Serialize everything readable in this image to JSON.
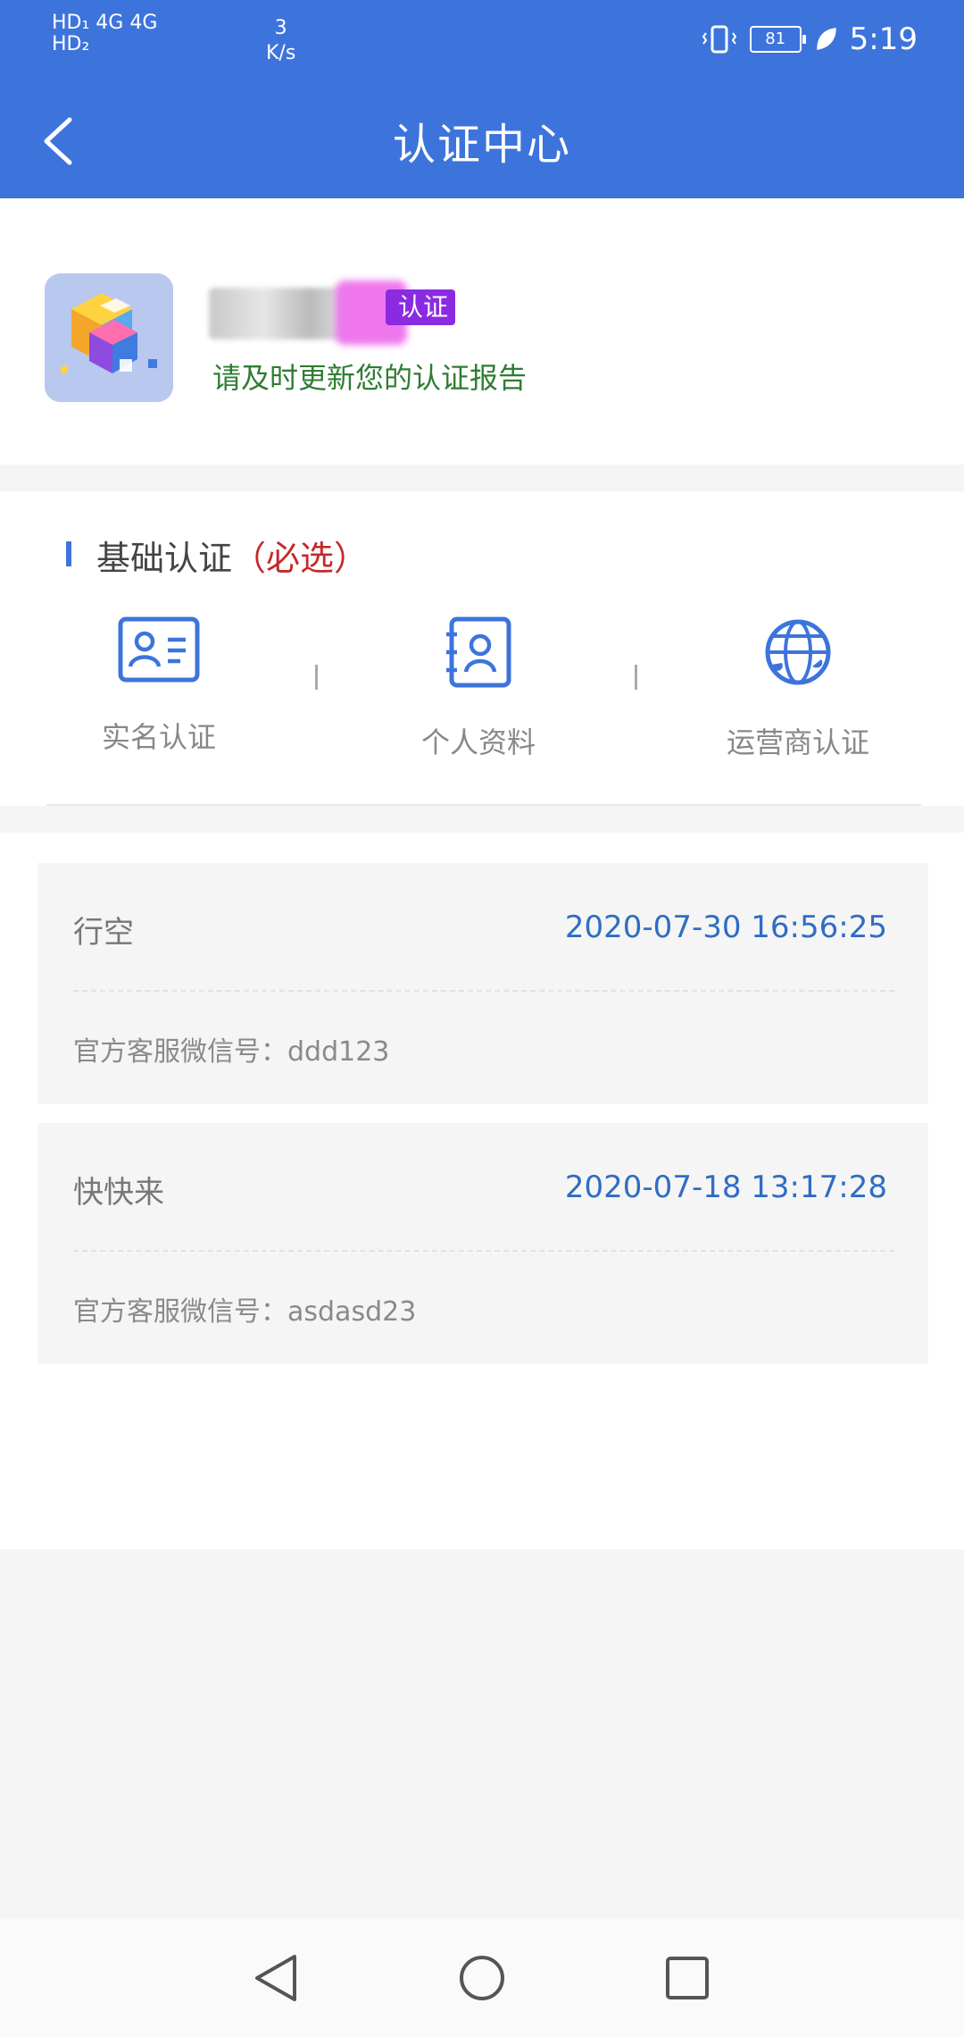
{
  "status_bar": {
    "left_line1": "HD₁ 4G 4G",
    "left_line2": "HD₂",
    "speed_value": "3",
    "speed_unit": "K/s",
    "battery": "81",
    "time": "5:19"
  },
  "header": {
    "title": "认证中心"
  },
  "profile": {
    "badge": "认证",
    "notice": "请及时更新您的认证报告"
  },
  "basic_cert": {
    "title": "基础认证",
    "required": "（必选）",
    "items": [
      {
        "label": "实名认证",
        "icon": "id-card-icon"
      },
      {
        "label": "个人资料",
        "icon": "profile-document-icon"
      },
      {
        "label": "运营商认证",
        "icon": "globe-phone-icon"
      }
    ]
  },
  "records": [
    {
      "name": "行空",
      "time": "2020-07-30 16:56:25",
      "wechat": "官方客服微信号：ddd123"
    },
    {
      "name": "快快来",
      "time": "2020-07-18 13:17:28",
      "wechat": "官方客服微信号：asdasd23"
    }
  ],
  "colors": {
    "header": "#3d74dc",
    "accent_blue": "#2f6dc3",
    "required_red": "#c62828",
    "notice_green": "#2e7d32",
    "badge_purple": "#8a2be2"
  }
}
